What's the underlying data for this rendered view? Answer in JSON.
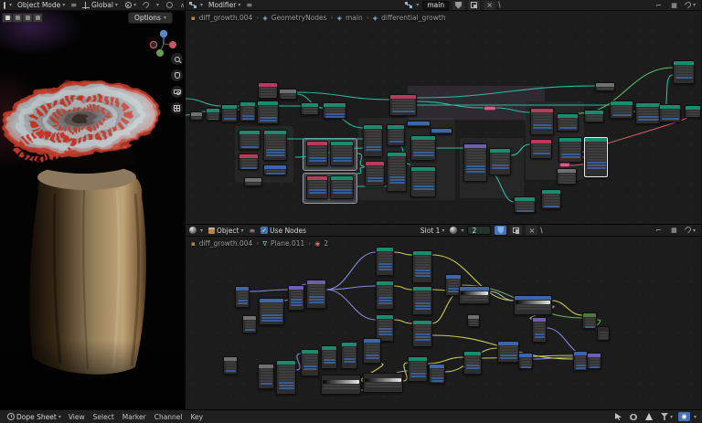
{
  "viewport": {
    "mode": "Object Mode",
    "orientation": "Global",
    "options": "Options"
  },
  "geo_editor": {
    "context": "Modifier",
    "tree_name": "main",
    "breadcrumb": [
      {
        "icon": "cube",
        "text": "diff_growth.004"
      },
      {
        "icon": "nodetree",
        "text": "GeometryNodes"
      },
      {
        "icon": "nodetree",
        "text": "main"
      },
      {
        "icon": "nodetree",
        "text": "differential_growth"
      }
    ]
  },
  "shader_editor": {
    "id_type": "Object",
    "use_nodes": "Use Nodes",
    "slot": "Slot 1",
    "material": "2",
    "breadcrumb": [
      {
        "icon": "cube",
        "text": "diff_growth.004"
      },
      {
        "icon": "nabla",
        "text": "Plane.011"
      },
      {
        "icon": "mat",
        "text": "2"
      }
    ]
  },
  "dope_sheet": {
    "editor": "Dope Sheet",
    "menus": [
      "View",
      "Select",
      "Marker",
      "Channel",
      "Key"
    ]
  },
  "palette": {
    "header": {
      "t": "#1d8a6e",
      "r": "#b83a5e",
      "b": "#3d65a8",
      "p": "#6f5fb0",
      "g": "#707070",
      "k": "#2b2b2b",
      "gn": "#4f7a3f"
    },
    "wire": {
      "t": "#2fb99a",
      "g": "#57c467",
      "r": "#d05c6e",
      "p": "#8585d8",
      "y": "#c6cc52",
      "w": "#a9a9a9",
      "gn": "#6fae5f",
      "b": "#6b8fd6"
    },
    "frame": {
      "d": "#262626",
      "l": "#43464a",
      "v": "rgba(150,110,165,0.16)"
    },
    "accent_blue": "#4772b3",
    "pill": "#d45d8a"
  },
  "geo_graph": {
    "frames": [
      [
        54,
        126,
        64,
        62,
        "d"
      ],
      [
        128,
        139,
        60,
        36,
        "l"
      ],
      [
        128,
        177,
        60,
        34,
        "l"
      ],
      [
        189,
        117,
        106,
        90,
        "d"
      ],
      [
        243,
        82,
        150,
        37,
        "v"
      ],
      [
        300,
        139,
        70,
        66,
        "d"
      ],
      [
        372,
        99,
        64,
        86,
        "d"
      ]
    ],
    "nodes": [
      [
        5,
        110,
        14,
        10,
        "g",
        2,
        0
      ],
      [
        22,
        106,
        16,
        14,
        "t",
        3,
        1
      ],
      [
        39,
        102,
        18,
        20,
        "t",
        4,
        1
      ],
      [
        59,
        99,
        18,
        22,
        "t",
        5,
        2
      ],
      [
        79,
        78,
        22,
        18,
        "r",
        4,
        0
      ],
      [
        78,
        98,
        24,
        26,
        "t",
        6,
        2
      ],
      [
        102,
        85,
        20,
        12,
        "g",
        2,
        0
      ],
      [
        126,
        100,
        20,
        14,
        "t",
        3,
        0
      ],
      [
        150,
        100,
        26,
        18,
        "t",
        4,
        2
      ],
      [
        58,
        130,
        24,
        22,
        "t",
        5,
        1
      ],
      [
        58,
        156,
        22,
        18,
        "r",
        4,
        1
      ],
      [
        85,
        130,
        26,
        34,
        "t",
        8,
        3
      ],
      [
        85,
        168,
        26,
        12,
        "b",
        2,
        1
      ],
      [
        64,
        182,
        20,
        10,
        "g",
        2,
        0
      ],
      [
        132,
        142,
        24,
        28,
        "r",
        6,
        2
      ],
      [
        158,
        142,
        26,
        28,
        "t",
        6,
        2
      ],
      [
        132,
        180,
        24,
        26,
        "r",
        5,
        2
      ],
      [
        158,
        180,
        26,
        26,
        "t",
        5,
        2
      ],
      [
        194,
        124,
        22,
        36,
        "t",
        8,
        2
      ],
      [
        220,
        124,
        20,
        24,
        "t",
        5,
        1
      ],
      [
        242,
        120,
        26,
        7,
        "b",
        0,
        0
      ],
      [
        246,
        136,
        28,
        28,
        "t",
        6,
        2
      ],
      [
        220,
        154,
        22,
        44,
        "t",
        10,
        3
      ],
      [
        246,
        170,
        28,
        34,
        "t",
        7,
        2
      ],
      [
        196,
        164,
        22,
        28,
        "r",
        6,
        2
      ],
      [
        268,
        128,
        24,
        7,
        "b",
        0,
        0
      ],
      [
        223,
        91,
        30,
        24,
        "r",
        5,
        1
      ],
      [
        304,
        145,
        26,
        42,
        "p",
        9,
        3
      ],
      [
        332,
        150,
        24,
        30,
        "t",
        6,
        2
      ],
      [
        377,
        106,
        26,
        30,
        "r",
        6,
        2
      ],
      [
        377,
        140,
        24,
        22,
        "r",
        4,
        1
      ],
      [
        406,
        112,
        24,
        20,
        "t",
        4,
        1
      ],
      [
        436,
        108,
        22,
        14,
        "t",
        3,
        0
      ],
      [
        408,
        138,
        26,
        28,
        "t",
        6,
        2
      ],
      [
        436,
        138,
        26,
        44,
        "t",
        10,
        3,
        0,
        1
      ],
      [
        406,
        172,
        22,
        18,
        "g",
        4,
        0
      ],
      [
        389,
        195,
        22,
        22,
        "t",
        5,
        1
      ],
      [
        464,
        98,
        26,
        20,
        "t",
        4,
        1
      ],
      [
        492,
        100,
        28,
        24,
        "t",
        5,
        2
      ],
      [
        518,
        102,
        24,
        20,
        "t",
        4,
        1
      ],
      [
        448,
        78,
        22,
        10,
        "g",
        2,
        0
      ],
      [
        533,
        54,
        24,
        26,
        "t",
        5,
        1
      ],
      [
        546,
        103,
        18,
        14,
        "t",
        3,
        0
      ],
      [
        359,
        203,
        24,
        18,
        "t",
        4,
        1
      ]
    ],
    "pills": [
      [
        326,
        104,
        14
      ],
      [
        409,
        166,
        12
      ]
    ],
    "wires": [
      [
        0,
        114,
        22,
        110,
        "t"
      ],
      [
        0,
        96,
        39,
        104,
        "t"
      ],
      [
        38,
        110,
        59,
        104,
        "t"
      ],
      [
        57,
        108,
        78,
        104,
        "t"
      ],
      [
        102,
        104,
        126,
        104,
        "t"
      ],
      [
        122,
        91,
        150,
        106,
        "t"
      ],
      [
        146,
        106,
        194,
        128,
        "t"
      ],
      [
        122,
        89,
        223,
        97,
        "t"
      ],
      [
        253,
        99,
        326,
        106,
        "t"
      ],
      [
        340,
        106,
        377,
        111,
        "t"
      ],
      [
        253,
        103,
        464,
        103,
        "t"
      ],
      [
        102,
        140,
        194,
        140,
        "t"
      ],
      [
        120,
        160,
        194,
        150,
        "t"
      ],
      [
        188,
        156,
        196,
        170,
        "t"
      ],
      [
        188,
        192,
        220,
        192,
        "t"
      ],
      [
        274,
        150,
        304,
        150,
        "t"
      ],
      [
        356,
        158,
        377,
        146,
        "t"
      ],
      [
        430,
        112,
        533,
        62,
        "g"
      ],
      [
        253,
        95,
        448,
        82,
        "t"
      ],
      [
        546,
        112,
        436,
        160,
        "r"
      ],
      [
        520,
        110,
        533,
        70,
        "t"
      ],
      [
        488,
        110,
        518,
        110,
        "t"
      ],
      [
        332,
        176,
        359,
        209,
        "t"
      ],
      [
        421,
        169,
        436,
        168,
        "r"
      ],
      [
        231,
        146,
        246,
        168,
        "t"
      ],
      [
        187,
        178,
        196,
        171,
        "t"
      ]
    ]
  },
  "shader_graph": {
    "frames": [],
    "nodes": [
      [
        54,
        54,
        16,
        24,
        "b",
        5,
        2
      ],
      [
        80,
        67,
        28,
        30,
        "b",
        7,
        3
      ],
      [
        62,
        86,
        16,
        20,
        "g",
        4,
        1
      ],
      [
        112,
        53,
        18,
        28,
        "p",
        6,
        3
      ],
      [
        132,
        47,
        22,
        32,
        "p",
        7,
        3
      ],
      [
        208,
        11,
        20,
        32,
        "t",
        7,
        3
      ],
      [
        208,
        48,
        20,
        32,
        "t",
        7,
        3
      ],
      [
        208,
        85,
        20,
        30,
        "t",
        6,
        3
      ],
      [
        248,
        15,
        22,
        36,
        "t",
        8,
        3
      ],
      [
        248,
        54,
        22,
        32,
        "t",
        7,
        3
      ],
      [
        248,
        91,
        22,
        30,
        "t",
        6,
        3
      ],
      [
        284,
        41,
        18,
        24,
        "b",
        5,
        2
      ],
      [
        299,
        54,
        34,
        20,
        "b",
        2,
        0,
        1
      ],
      [
        359,
        64,
        42,
        22,
        "b",
        2,
        0,
        1
      ],
      [
        308,
        85,
        14,
        14,
        "g",
        3,
        0
      ],
      [
        379,
        88,
        16,
        28,
        "p",
        6,
        2
      ],
      [
        341,
        114,
        24,
        24,
        "b",
        5,
        2
      ],
      [
        364,
        127,
        16,
        18,
        "b",
        4,
        1
      ],
      [
        304,
        125,
        20,
        26,
        "t",
        5,
        2
      ],
      [
        434,
        83,
        16,
        18,
        "gn",
        4,
        1
      ],
      [
        450,
        98,
        14,
        16,
        "k",
        3,
        0
      ],
      [
        424,
        125,
        16,
        22,
        "b",
        5,
        2
      ],
      [
        439,
        127,
        16,
        18,
        "p",
        4,
        1
      ],
      [
        79,
        139,
        18,
        28,
        "g",
        6,
        1
      ],
      [
        99,
        135,
        22,
        38,
        "t",
        9,
        3
      ],
      [
        126,
        123,
        20,
        30,
        "t",
        6,
        2
      ],
      [
        148,
        119,
        18,
        26,
        "t",
        5,
        2
      ],
      [
        170,
        115,
        18,
        30,
        "t",
        6,
        2
      ],
      [
        194,
        111,
        20,
        28,
        "b",
        6,
        2
      ],
      [
        148,
        151,
        44,
        22,
        "k",
        2,
        0,
        1
      ],
      [
        194,
        149,
        44,
        22,
        "k",
        2,
        0,
        1
      ],
      [
        243,
        131,
        22,
        28,
        "t",
        6,
        2
      ],
      [
        266,
        139,
        18,
        22,
        "b",
        5,
        2
      ],
      [
        41,
        131,
        16,
        20,
        "g",
        4,
        1
      ]
    ],
    "pills": [],
    "wires": [
      [
        154,
        58,
        208,
        17,
        "p"
      ],
      [
        154,
        58,
        208,
        54,
        "p"
      ],
      [
        154,
        58,
        208,
        91,
        "p"
      ],
      [
        70,
        60,
        112,
        58,
        "p"
      ],
      [
        108,
        70,
        132,
        52,
        "p"
      ],
      [
        228,
        17,
        248,
        20,
        "y"
      ],
      [
        228,
        54,
        248,
        58,
        "y"
      ],
      [
        228,
        91,
        248,
        95,
        "y"
      ],
      [
        270,
        20,
        359,
        70,
        "y"
      ],
      [
        270,
        58,
        299,
        60,
        "y"
      ],
      [
        270,
        95,
        299,
        62,
        "y"
      ],
      [
        333,
        60,
        359,
        70,
        "w"
      ],
      [
        401,
        70,
        434,
        86,
        "y"
      ],
      [
        401,
        76,
        379,
        90,
        "w"
      ],
      [
        302,
        53,
        434,
        89,
        "gn"
      ],
      [
        450,
        91,
        452,
        101,
        "gn"
      ],
      [
        238,
        158,
        243,
        138,
        "y"
      ],
      [
        265,
        139,
        304,
        132,
        "y"
      ],
      [
        284,
        148,
        341,
        122,
        "y"
      ],
      [
        324,
        133,
        424,
        130,
        "y"
      ],
      [
        380,
        134,
        424,
        132,
        "p"
      ],
      [
        395,
        100,
        439,
        130,
        "p"
      ],
      [
        214,
        139,
        194,
        158,
        "y"
      ],
      [
        121,
        146,
        126,
        128,
        "p"
      ],
      [
        192,
        168,
        243,
        147,
        "w"
      ],
      [
        270,
        108,
        424,
        134,
        "y"
      ]
    ]
  }
}
